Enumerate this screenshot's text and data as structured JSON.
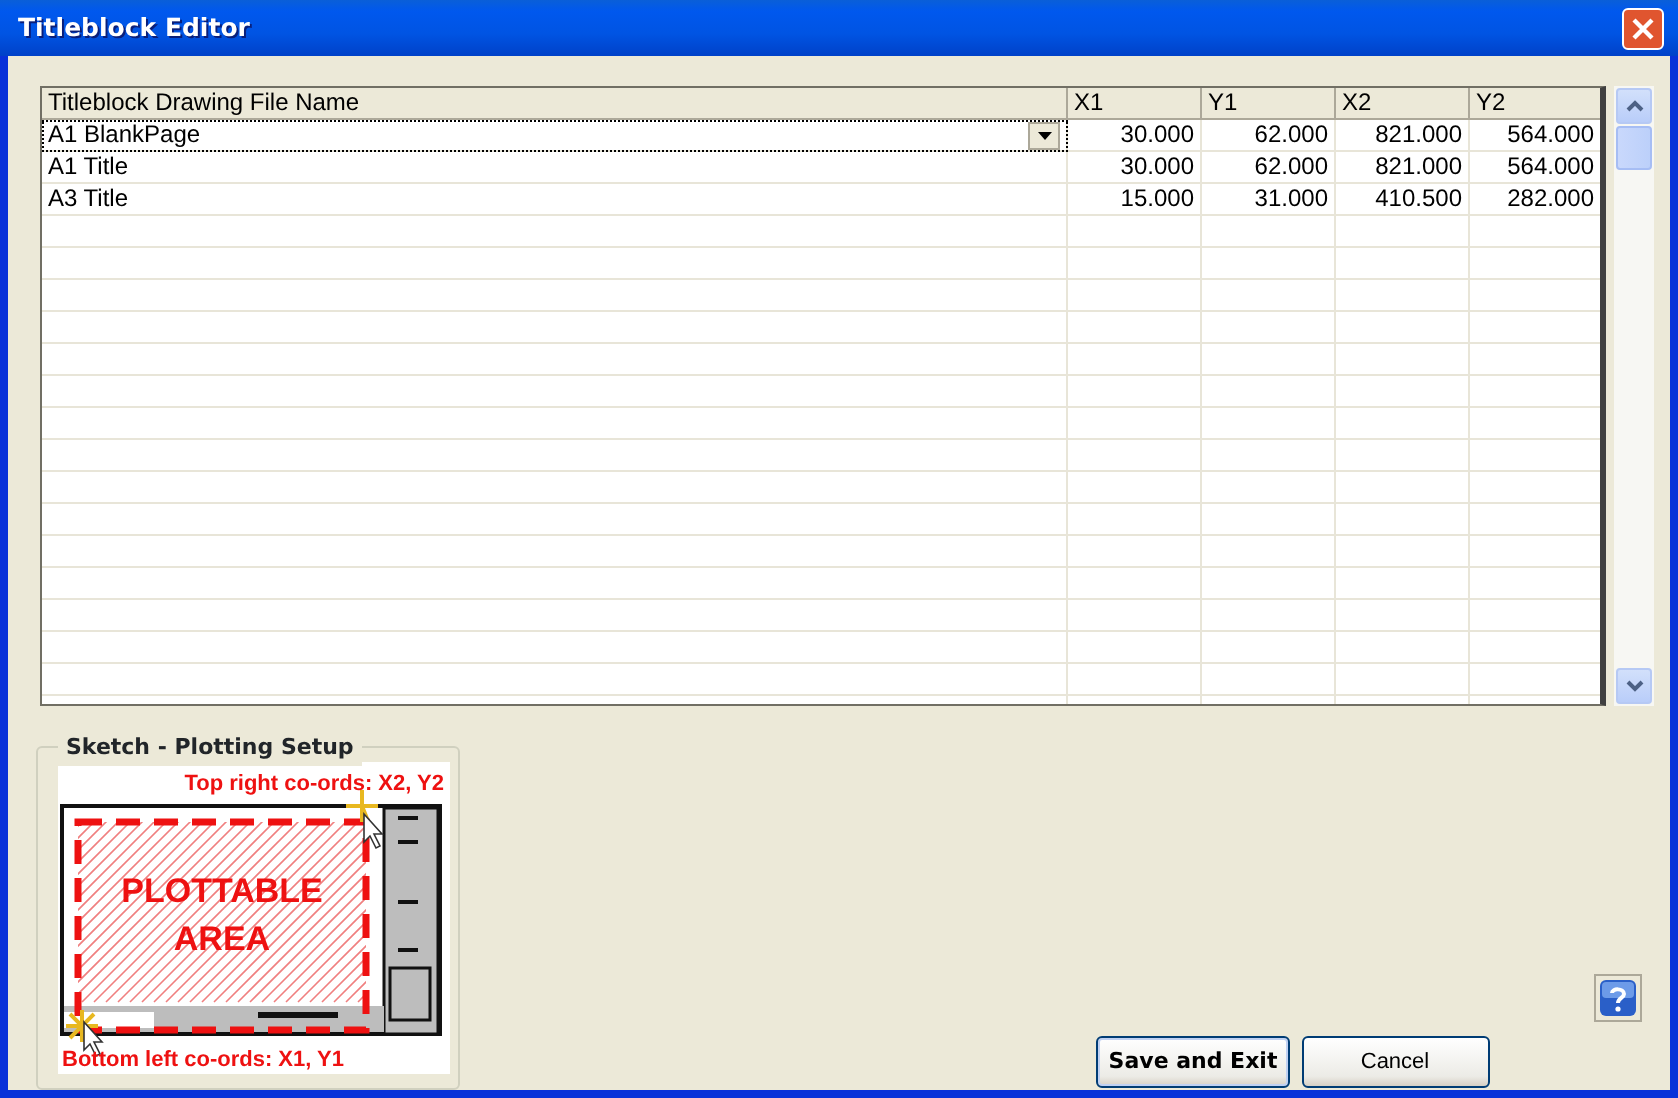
{
  "window": {
    "title": "Titleblock Editor"
  },
  "table": {
    "columns": [
      "Titleblock Drawing File Name",
      "X1",
      "Y1",
      "X2",
      "Y2"
    ],
    "rows": [
      {
        "cells": [
          "A1 BlankPage",
          "30.000",
          "62.000",
          "821.000",
          "564.000"
        ],
        "selected": true
      },
      {
        "cells": [
          "A1 Title",
          "30.000",
          "62.000",
          "821.000",
          "564.000"
        ],
        "selected": false
      },
      {
        "cells": [
          "A3 Title",
          "15.000",
          "31.000",
          "410.500",
          "282.000"
        ],
        "selected": false
      }
    ]
  },
  "sketch": {
    "title": "Sketch - Plotting Setup",
    "top_label": "Top right co-ords: X2, Y2",
    "area_lines": [
      "PLOTTABLE",
      "AREA"
    ],
    "bottom_label": "Bottom left co-ords: X1, Y1"
  },
  "buttons": [
    {
      "label": "Save and Exit",
      "kind": "default"
    },
    {
      "label": "Cancel",
      "kind": "normal"
    }
  ]
}
